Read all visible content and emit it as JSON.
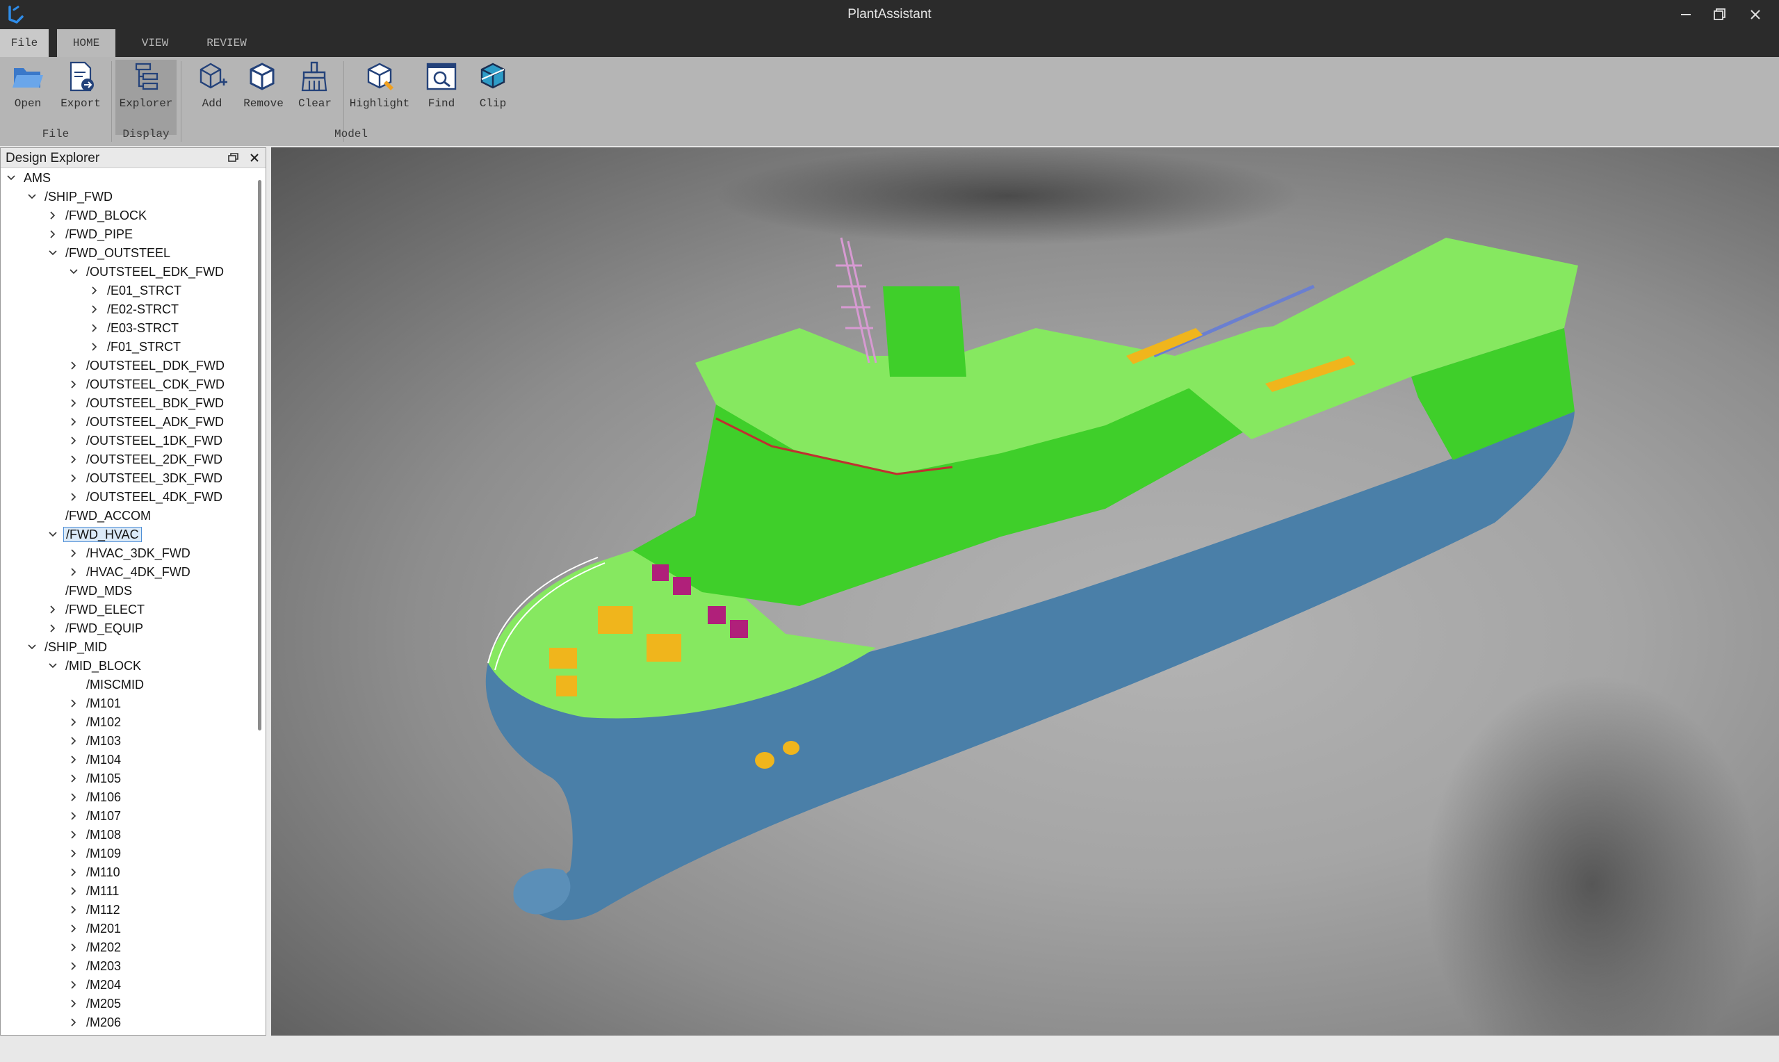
{
  "app": {
    "title": "PlantAssistant"
  },
  "tabs": [
    {
      "label": "File",
      "active": false
    },
    {
      "label": "HOME",
      "active": true
    },
    {
      "label": "VIEW",
      "active": false
    },
    {
      "label": "REVIEW",
      "active": false
    }
  ],
  "ribbon": {
    "buttons": {
      "open": "Open",
      "export": "Export",
      "explorer": "Explorer",
      "add": "Add",
      "remove": "Remove",
      "clear": "Clear",
      "highlight": "Highlight",
      "find": "Find",
      "clip": "Clip"
    },
    "groups": {
      "file": "File",
      "display": "Display",
      "model": "Model"
    }
  },
  "explorer": {
    "title": "Design Explorer",
    "nodes": [
      {
        "label": "AMS",
        "level": 0,
        "state": "expanded"
      },
      {
        "label": "/SHIP_FWD",
        "level": 1,
        "state": "expanded"
      },
      {
        "label": "/FWD_BLOCK",
        "level": 2,
        "state": "collapsed"
      },
      {
        "label": "/FWD_PIPE",
        "level": 2,
        "state": "collapsed"
      },
      {
        "label": "/FWD_OUTSTEEL",
        "level": 2,
        "state": "expanded"
      },
      {
        "label": "/OUTSTEEL_EDK_FWD",
        "level": 3,
        "state": "expanded"
      },
      {
        "label": "/E01_STRCT",
        "level": 4,
        "state": "collapsed"
      },
      {
        "label": "/E02-STRCT",
        "level": 4,
        "state": "collapsed"
      },
      {
        "label": "/E03-STRCT",
        "level": 4,
        "state": "collapsed"
      },
      {
        "label": "/F01_STRCT",
        "level": 4,
        "state": "collapsed"
      },
      {
        "label": "/OUTSTEEL_DDK_FWD",
        "level": 3,
        "state": "collapsed"
      },
      {
        "label": "/OUTSTEEL_CDK_FWD",
        "level": 3,
        "state": "collapsed"
      },
      {
        "label": "/OUTSTEEL_BDK_FWD",
        "level": 3,
        "state": "collapsed"
      },
      {
        "label": "/OUTSTEEL_ADK_FWD",
        "level": 3,
        "state": "collapsed"
      },
      {
        "label": "/OUTSTEEL_1DK_FWD",
        "level": 3,
        "state": "collapsed"
      },
      {
        "label": "/OUTSTEEL_2DK_FWD",
        "level": 3,
        "state": "collapsed"
      },
      {
        "label": "/OUTSTEEL_3DK_FWD",
        "level": 3,
        "state": "collapsed"
      },
      {
        "label": "/OUTSTEEL_4DK_FWD",
        "level": 3,
        "state": "collapsed"
      },
      {
        "label": "/FWD_ACCOM",
        "level": 2,
        "state": "leaf"
      },
      {
        "label": "/FWD_HVAC",
        "level": 2,
        "state": "expanded",
        "selected": true
      },
      {
        "label": "/HVAC_3DK_FWD",
        "level": 3,
        "state": "collapsed"
      },
      {
        "label": "/HVAC_4DK_FWD",
        "level": 3,
        "state": "collapsed"
      },
      {
        "label": "/FWD_MDS",
        "level": 2,
        "state": "leaf"
      },
      {
        "label": "/FWD_ELECT",
        "level": 2,
        "state": "collapsed"
      },
      {
        "label": "/FWD_EQUIP",
        "level": 2,
        "state": "collapsed"
      },
      {
        "label": "/SHIP_MID",
        "level": 1,
        "state": "expanded"
      },
      {
        "label": "/MID_BLOCK",
        "level": 2,
        "state": "expanded"
      },
      {
        "label": "/MISCMID",
        "level": 3,
        "state": "leaf"
      },
      {
        "label": "/M101",
        "level": 3,
        "state": "collapsed"
      },
      {
        "label": "/M102",
        "level": 3,
        "state": "collapsed"
      },
      {
        "label": "/M103",
        "level": 3,
        "state": "collapsed"
      },
      {
        "label": "/M104",
        "level": 3,
        "state": "collapsed"
      },
      {
        "label": "/M105",
        "level": 3,
        "state": "collapsed"
      },
      {
        "label": "/M106",
        "level": 3,
        "state": "collapsed"
      },
      {
        "label": "/M107",
        "level": 3,
        "state": "collapsed"
      },
      {
        "label": "/M108",
        "level": 3,
        "state": "collapsed"
      },
      {
        "label": "/M109",
        "level": 3,
        "state": "collapsed"
      },
      {
        "label": "/M110",
        "level": 3,
        "state": "collapsed"
      },
      {
        "label": "/M111",
        "level": 3,
        "state": "collapsed"
      },
      {
        "label": "/M112",
        "level": 3,
        "state": "collapsed"
      },
      {
        "label": "/M201",
        "level": 3,
        "state": "collapsed"
      },
      {
        "label": "/M202",
        "level": 3,
        "state": "collapsed"
      },
      {
        "label": "/M203",
        "level": 3,
        "state": "collapsed"
      },
      {
        "label": "/M204",
        "level": 3,
        "state": "collapsed"
      },
      {
        "label": "/M205",
        "level": 3,
        "state": "collapsed"
      },
      {
        "label": "/M206",
        "level": 3,
        "state": "collapsed"
      }
    ]
  },
  "colors": {
    "accent": "#1e7be0",
    "hull": "#4a7fa8",
    "superstructure": "#4fd63a",
    "deck": "#86e860",
    "equipment": "#f0b51c",
    "hvac": "#b0207a",
    "piping": "#d88cd0"
  },
  "icons": {
    "open": "folder-open-icon",
    "export": "export-icon",
    "explorer": "tree-explorer-icon",
    "add": "cube-add-icon",
    "remove": "cube-remove-icon",
    "clear": "broom-icon",
    "highlight": "cube-highlight-icon",
    "find": "find-icon",
    "clip": "clip-cube-icon",
    "help": "help-icon",
    "info": "info-icon"
  }
}
